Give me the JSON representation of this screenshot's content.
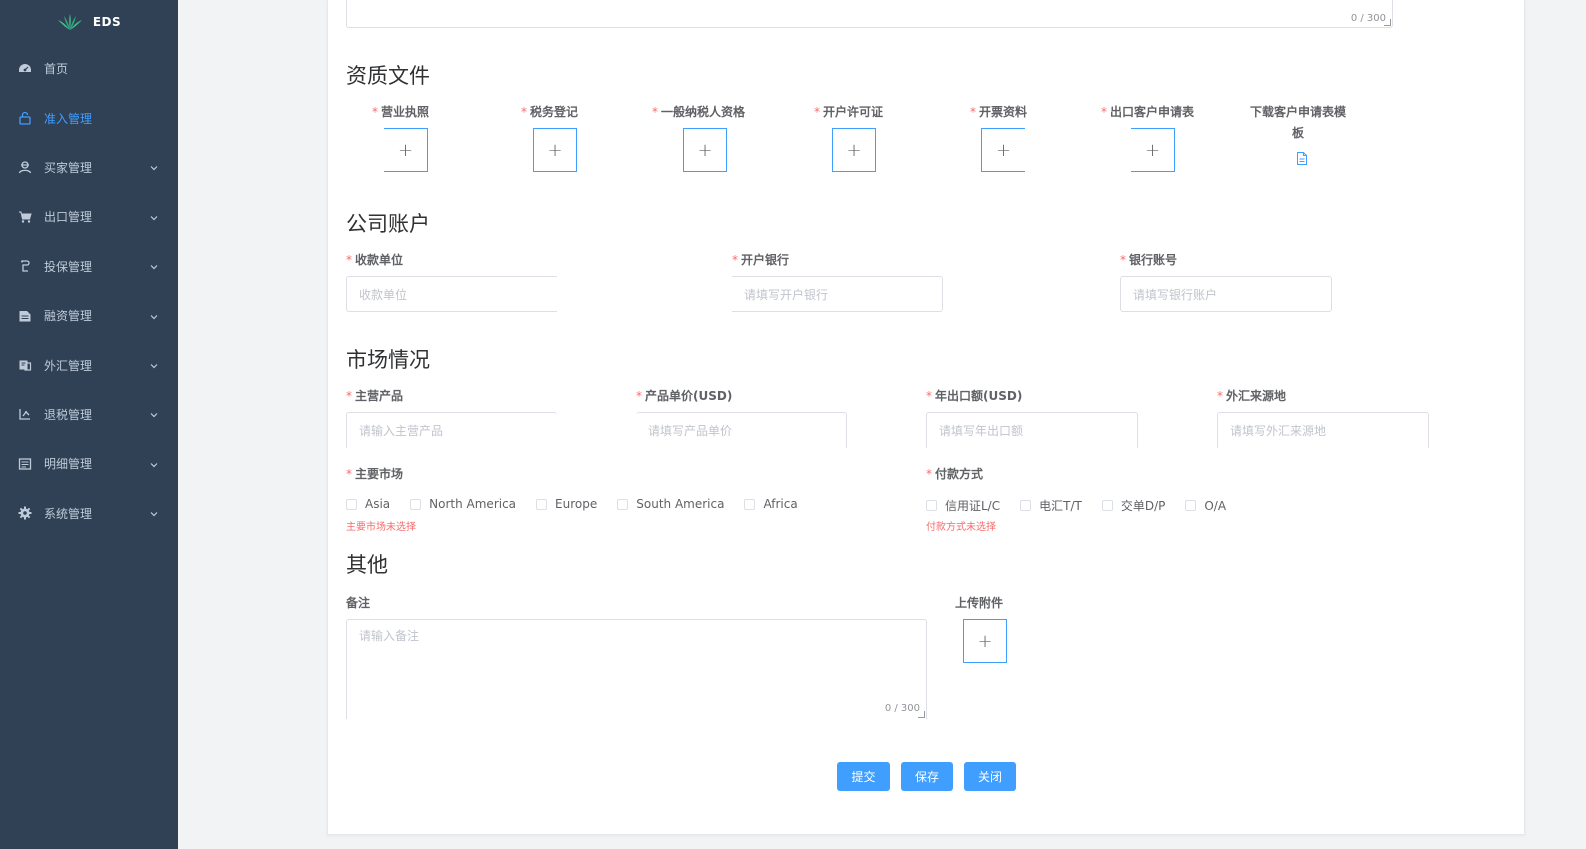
{
  "app": {
    "name": "EDS"
  },
  "colors": {
    "sidebar": "#304156",
    "accent": "#409eff",
    "danger": "#f56c6c"
  },
  "sidebar": {
    "items": [
      {
        "label": "首页",
        "icon": "dashboard-icon",
        "active": false,
        "expandable": false
      },
      {
        "label": "准入管理",
        "icon": "lock-open-icon",
        "active": true,
        "expandable": false
      },
      {
        "label": "买家管理",
        "icon": "user-group-icon",
        "active": false,
        "expandable": true
      },
      {
        "label": "出口管理",
        "icon": "cart-icon",
        "active": false,
        "expandable": true
      },
      {
        "label": "投保管理",
        "icon": "shield-icon",
        "active": false,
        "expandable": true
      },
      {
        "label": "融资管理",
        "icon": "document-icon",
        "active": false,
        "expandable": true
      },
      {
        "label": "外汇管理",
        "icon": "exchange-icon",
        "active": false,
        "expandable": true
      },
      {
        "label": "退税管理",
        "icon": "refund-icon",
        "active": false,
        "expandable": true
      },
      {
        "label": "明细管理",
        "icon": "list-icon",
        "active": false,
        "expandable": true
      },
      {
        "label": "系统管理",
        "icon": "gear-icon",
        "active": false,
        "expandable": true
      }
    ]
  },
  "top_textarea": {
    "counter": "0 / 300"
  },
  "qualification": {
    "title": "资质文件",
    "items": [
      {
        "label": "营业执照",
        "required": true
      },
      {
        "label": "税务登记",
        "required": true
      },
      {
        "label": "一般纳税人资格",
        "required": true
      },
      {
        "label": "开户许可证",
        "required": true
      },
      {
        "label": "开票资料",
        "required": true
      },
      {
        "label": "出口客户申请表",
        "required": true
      }
    ],
    "template_label_line1": "下载客户申请表模",
    "template_label_line2": "板",
    "upload_symbol": "+"
  },
  "account": {
    "title": "公司账户",
    "fields": [
      {
        "label": "收款单位",
        "placeholder": "收款单位"
      },
      {
        "label": "开户银行",
        "placeholder": "请填写开户银行"
      },
      {
        "label": "银行账号",
        "placeholder": "请填写银行账户"
      }
    ]
  },
  "market": {
    "title": "市场情况",
    "fields": [
      {
        "label": "主营产品",
        "placeholder": "请输入主营产品"
      },
      {
        "label": "产品单价(USD)",
        "placeholder": "请填写产品单价"
      },
      {
        "label": "年出口额(USD)",
        "placeholder": "请填写年出口额"
      },
      {
        "label": "外汇来源地",
        "placeholder": "请填写外汇来源地"
      }
    ],
    "main_market": {
      "label": "主要市场",
      "options": [
        "Asia",
        "North America",
        "Europe",
        "South America",
        "Africa"
      ],
      "error": "主要市场未选择"
    },
    "payment": {
      "label": "付款方式",
      "options": [
        "信用证L/C",
        "电汇T/T",
        "交单D/P",
        "O/A"
      ],
      "error": "付款方式未选择"
    }
  },
  "other": {
    "title": "其他",
    "remark_label": "备注",
    "remark_placeholder": "请输入备注",
    "remark_counter": "0 / 300",
    "attachment_label": "上传附件"
  },
  "buttons": {
    "submit": "提交",
    "save": "保存",
    "close": "关闭"
  }
}
